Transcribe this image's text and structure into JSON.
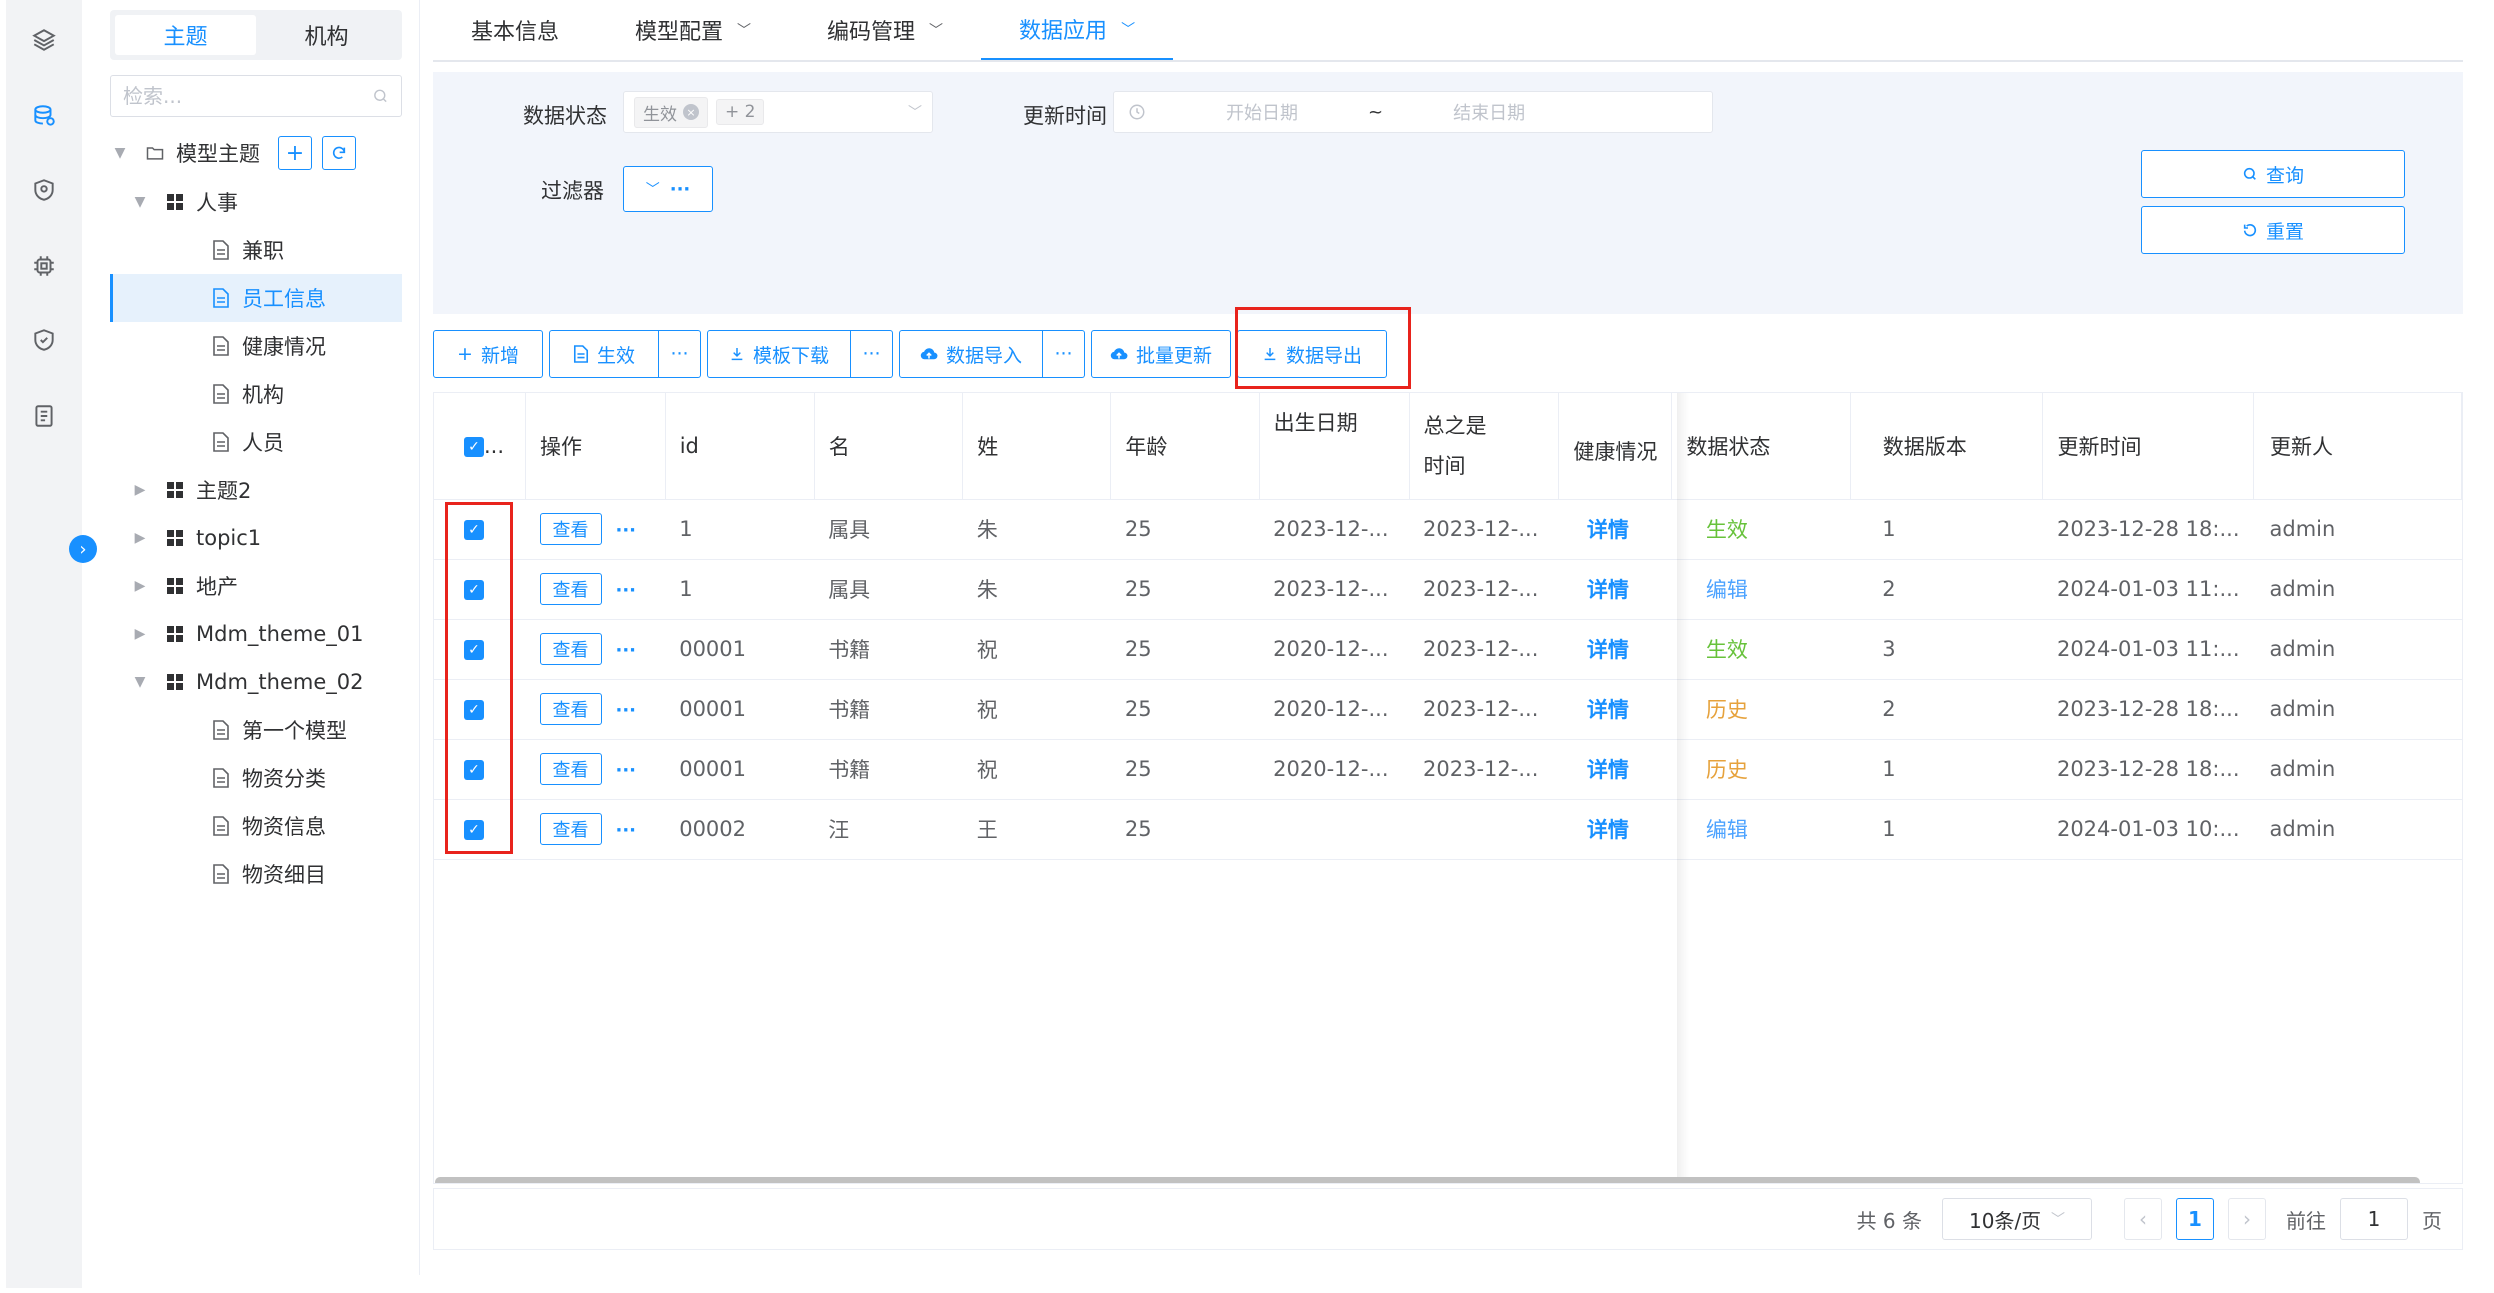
{
  "rail": {
    "icons": [
      "layers-icon",
      "database-icon",
      "shield-icon",
      "chip-icon",
      "shield-check-icon",
      "document-icon"
    ]
  },
  "tree": {
    "tabs": [
      "主题",
      "机构"
    ],
    "search_placeholder": "检索...",
    "root": "模型主题",
    "items": [
      {
        "label": "人事",
        "type": "group"
      },
      {
        "label": "兼职",
        "type": "leaf"
      },
      {
        "label": "员工信息",
        "type": "leaf"
      },
      {
        "label": "健康情况",
        "type": "leaf"
      },
      {
        "label": "机构",
        "type": "leaf"
      },
      {
        "label": "人员",
        "type": "leaf"
      },
      {
        "label": "主题2",
        "type": "group"
      },
      {
        "label": "topic1",
        "type": "group"
      },
      {
        "label": "地产",
        "type": "group"
      },
      {
        "label": "Mdm_theme_01",
        "type": "group"
      },
      {
        "label": "Mdm_theme_02",
        "type": "group"
      },
      {
        "label": "第一个模型",
        "type": "leaf"
      },
      {
        "label": "物资分类",
        "type": "leaf"
      },
      {
        "label": "物资信息",
        "type": "leaf"
      },
      {
        "label": "物资细目",
        "type": "leaf"
      }
    ]
  },
  "tabs": [
    "基本信息",
    "模型配置",
    "编码管理",
    "数据应用"
  ],
  "filter": {
    "status_label": "数据状态",
    "status_chip": "生效",
    "status_more": "+ 2",
    "time_label": "更新时间",
    "date_start_placeholder": "开始日期",
    "date_sep": "~",
    "date_end_placeholder": "结束日期",
    "filter_label": "过滤器",
    "query_btn": "查询",
    "reset_btn": "重置"
  },
  "toolbar": {
    "add": "新增",
    "effect": "生效",
    "more": "···",
    "template_download": "模板下载",
    "data_import": "数据导入",
    "batch_update": "批量更新",
    "data_export": "数据导出"
  },
  "table": {
    "columns": [
      "操作",
      "id",
      "名",
      "姓",
      "年龄",
      "出生日期",
      "总之是时间",
      "健康情况",
      "数据状态",
      "数据版本",
      "更新时间",
      "更新人"
    ],
    "select_all_suffix": "...",
    "view_label": "查看",
    "row_more": "···",
    "rows": [
      {
        "id": "1",
        "ming": "属具",
        "xing": "朱",
        "age": "25",
        "birth": "2023-12-...",
        "time": "2023-12-...",
        "health": "详情",
        "status": "生效",
        "status_color": "#67c23a",
        "version": "1",
        "updated": "2023-12-28 18:...",
        "user": "admin"
      },
      {
        "id": "1",
        "ming": "属具",
        "xing": "朱",
        "age": "25",
        "birth": "2023-12-...",
        "time": "2023-12-...",
        "health": "详情",
        "status": "编辑",
        "status_color": "#4da3ff",
        "version": "2",
        "updated": "2024-01-03 11:...",
        "user": "admin"
      },
      {
        "id": "00001",
        "ming": "书籍",
        "xing": "祝",
        "age": "25",
        "birth": "2020-12-...",
        "time": "2023-12-...",
        "health": "详情",
        "status": "生效",
        "status_color": "#67c23a",
        "version": "3",
        "updated": "2024-01-03 11:...",
        "user": "admin"
      },
      {
        "id": "00001",
        "ming": "书籍",
        "xing": "祝",
        "age": "25",
        "birth": "2020-12-...",
        "time": "2023-12-...",
        "health": "详情",
        "status": "历史",
        "status_color": "#e6a23c",
        "version": "2",
        "updated": "2023-12-28 18:...",
        "user": "admin"
      },
      {
        "id": "00001",
        "ming": "书籍",
        "xing": "祝",
        "age": "25",
        "birth": "2020-12-...",
        "time": "2023-12-...",
        "health": "详情",
        "status": "历史",
        "status_color": "#e6a23c",
        "version": "1",
        "updated": "2023-12-28 18:...",
        "user": "admin"
      },
      {
        "id": "00002",
        "ming": "汪",
        "xing": "王",
        "age": "25",
        "birth": "",
        "time": "",
        "health": "详情",
        "status": "编辑",
        "status_color": "#4da3ff",
        "version": "1",
        "updated": "2024-01-03 10:...",
        "user": "admin"
      }
    ]
  },
  "pager": {
    "total": "共 6 条",
    "page_size": "10条/页",
    "current": "1",
    "goto_label": "前往",
    "goto_value": "1",
    "page_suffix": "页"
  }
}
